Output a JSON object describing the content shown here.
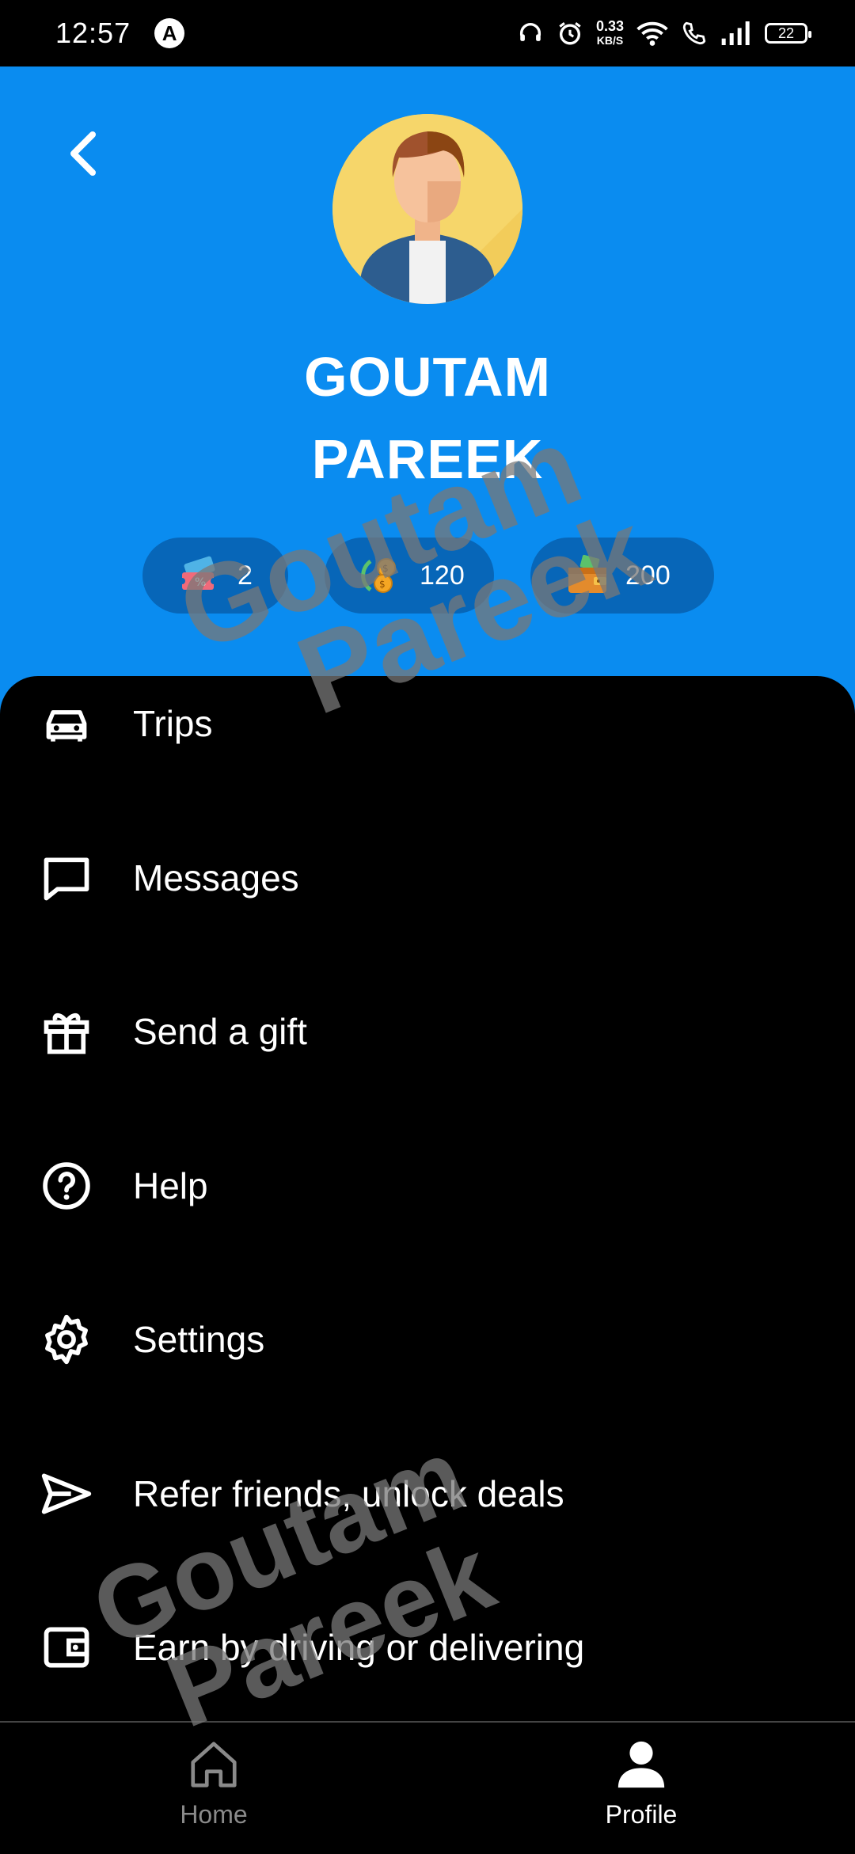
{
  "status_bar": {
    "time": "12:57",
    "app_badge": "A",
    "speed_value": "0.33",
    "speed_unit": "KB/S",
    "battery": "22",
    "icons": [
      "headset-icon",
      "alarm-icon",
      "wifi-icon",
      "call-icon",
      "signal-icon",
      "battery-icon"
    ]
  },
  "header": {
    "name_line1": "GOUTAM",
    "name_line2": "PAREEK",
    "background_color": "#0a8cf0",
    "stats": [
      {
        "icon": "coupon-icon",
        "value": "2"
      },
      {
        "icon": "coins-icon",
        "value": "120"
      },
      {
        "icon": "wallet-icon",
        "value": "200"
      }
    ]
  },
  "menu": [
    {
      "icon": "car-icon",
      "label": "Trips"
    },
    {
      "icon": "message-icon",
      "label": "Messages"
    },
    {
      "icon": "gift-icon",
      "label": "Send a gift"
    },
    {
      "icon": "help-icon",
      "label": "Help"
    },
    {
      "icon": "settings-icon",
      "label": "Settings"
    },
    {
      "icon": "send-icon",
      "label": "Refer friends, unlock deals"
    },
    {
      "icon": "wallet-outline-icon",
      "label": "Earn by driving or delivering"
    }
  ],
  "bottom_nav": {
    "home_label": "Home",
    "profile_label": "Profile",
    "active": "Profile"
  },
  "watermark": {
    "line1": "Goutam",
    "line2": "Pareek"
  }
}
